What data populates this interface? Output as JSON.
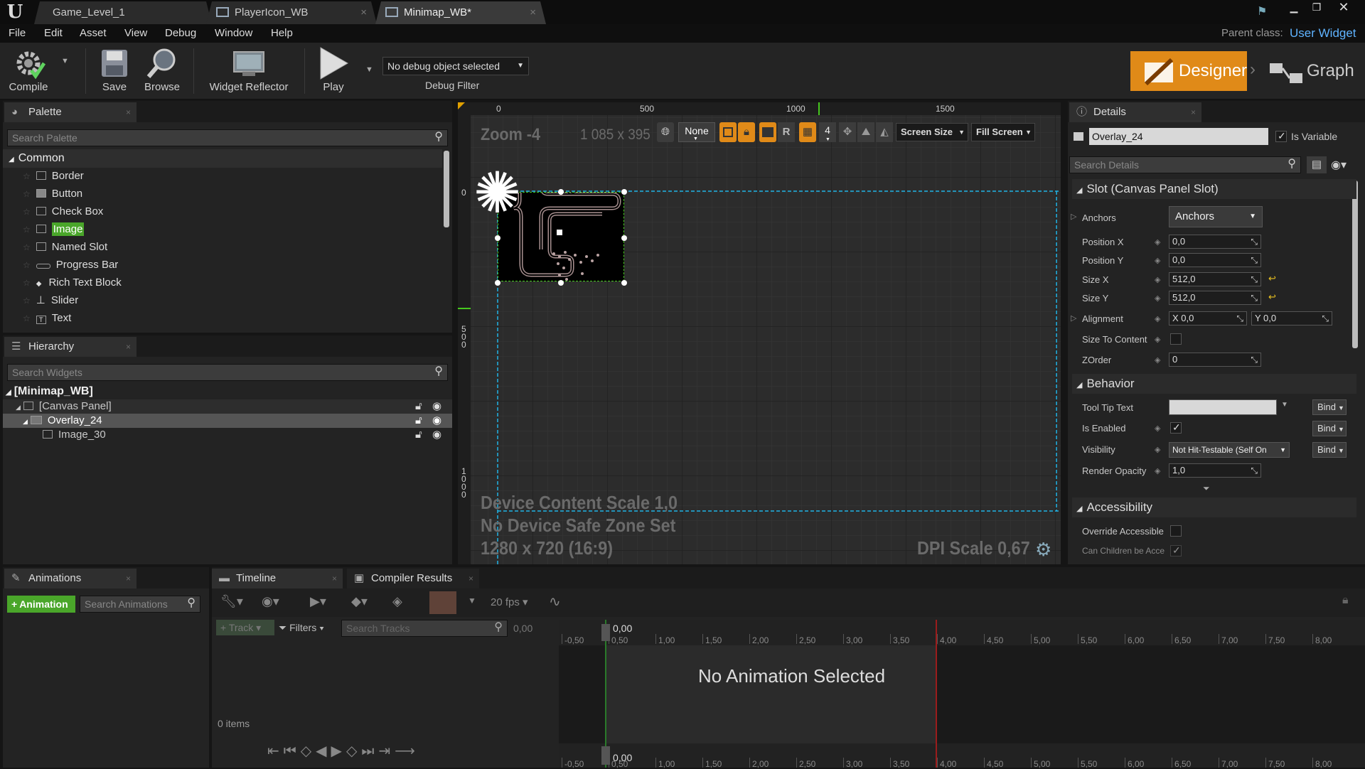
{
  "window": {
    "tabs": [
      {
        "label": "Game_Level_1"
      },
      {
        "label": "PlayerIcon_WB"
      },
      {
        "label": "Minimap_WB*"
      }
    ]
  },
  "menu": [
    "File",
    "Edit",
    "Asset",
    "View",
    "Debug",
    "Window",
    "Help"
  ],
  "parent_class": {
    "label": "Parent class:",
    "value": "User Widget"
  },
  "toolbar": {
    "compile": "Compile",
    "save": "Save",
    "browse": "Browse",
    "widget_reflector": "Widget Reflector",
    "play": "Play",
    "debug_object": "No debug object selected",
    "debug_filter": "Debug Filter",
    "designer": "Designer",
    "graph": "Graph"
  },
  "palette": {
    "title": "Palette",
    "search_placeholder": "Search Palette",
    "category": "Common",
    "items": [
      "Border",
      "Button",
      "Check Box",
      "Image",
      "Named Slot",
      "Progress Bar",
      "Rich Text Block",
      "Slider",
      "Text"
    ],
    "selected": "Image"
  },
  "hierarchy": {
    "title": "Hierarchy",
    "search_placeholder": "Search Widgets",
    "root": "[Minimap_WB]",
    "canvas": "[Canvas Panel]",
    "overlay": "Overlay_24",
    "image": "Image_30"
  },
  "designer": {
    "zoom": "Zoom -4",
    "size": "1 085 x 395",
    "ruler_top": [
      "0",
      "500",
      "1000",
      "1500"
    ],
    "ruler_left": [
      "0",
      "5\n0\n0",
      "1\n0\n0\n0"
    ],
    "none_btn": "None",
    "r_btn": "R",
    "grid_num": "4",
    "screen_size": "Screen Size",
    "fill_screen": "Fill Screen",
    "device_scale": "Device Content Scale 1,0",
    "safe_zone": "No Device Safe Zone Set",
    "resolution": "1280 x 720 (16:9)",
    "dpi": "DPI Scale 0,67"
  },
  "details": {
    "title": "Details",
    "name": "Overlay_24",
    "is_variable": "Is Variable",
    "search_placeholder": "Search Details",
    "slot_section": "Slot (Canvas Panel Slot)",
    "anchors_label": "Anchors",
    "anchors_value": "Anchors",
    "position_x_label": "Position X",
    "position_x": "0,0",
    "position_y_label": "Position Y",
    "position_y": "0,0",
    "size_x_label": "Size X",
    "size_x": "512,0",
    "size_y_label": "Size Y",
    "size_y": "512,0",
    "alignment_label": "Alignment",
    "alignment_x": "X  0,0",
    "alignment_y": "Y  0,0",
    "size_to_content": "Size To Content",
    "zorder_label": "ZOrder",
    "zorder": "0",
    "behavior_section": "Behavior",
    "tooltip_label": "Tool Tip Text",
    "bind": "Bind",
    "is_enabled_label": "Is Enabled",
    "visibility_label": "Visibility",
    "visibility_value": "Not Hit-Testable (Self On",
    "render_opacity_label": "Render Opacity",
    "render_opacity": "1,0",
    "accessibility_section": "Accessibility",
    "override_accessible": "Override Accessible",
    "can_children": "Can Children be Acce"
  },
  "animations": {
    "title": "Animations",
    "add_button": "Animation",
    "search_placeholder": "Search Animations"
  },
  "timeline": {
    "title": "Timeline",
    "compiler_title": "Compiler Results",
    "fps": "20 fps",
    "track_btn": "Track",
    "filters_btn": "Filters",
    "search_placeholder": "Search Tracks",
    "time_value": "0,00",
    "playhead": "0,00",
    "items": "0 items",
    "empty": "No Animation Selected",
    "ticks": [
      "-0,50",
      "0,50",
      "1,00",
      "1,50",
      "2,00",
      "2,50",
      "3,00",
      "3,50",
      "4,00",
      "4,50",
      "5,00",
      "5,50",
      "6,00",
      "6,50",
      "7,00",
      "7,50",
      "8,00"
    ]
  },
  "colors": {
    "accent": "#e08a18",
    "selection_green": "#46c81e",
    "guide_blue": "#1eb4e6"
  }
}
